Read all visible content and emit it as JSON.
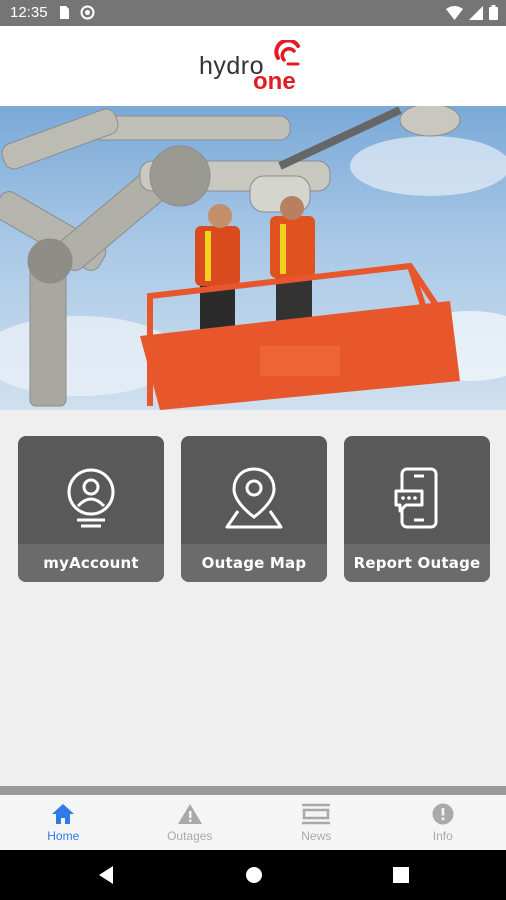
{
  "status_bar": {
    "time": "12:35"
  },
  "header": {
    "logo_word1": "hydro",
    "logo_word2": "one"
  },
  "colors": {
    "brand_red": "#e31b23",
    "tile_bg": "#595959",
    "active_nav": "#2f7be6"
  },
  "tiles": [
    {
      "label": "myAccount",
      "icon": "account-icon"
    },
    {
      "label": "Outage Map",
      "icon": "map-pin-icon"
    },
    {
      "label": "Report Outage",
      "icon": "phone-chat-icon"
    }
  ],
  "bottom_nav": [
    {
      "label": "Home",
      "icon": "home-icon",
      "active": true
    },
    {
      "label": "Outages",
      "icon": "warning-icon",
      "active": false
    },
    {
      "label": "News",
      "icon": "news-icon",
      "active": false
    },
    {
      "label": "Info",
      "icon": "info-icon",
      "active": false
    }
  ]
}
